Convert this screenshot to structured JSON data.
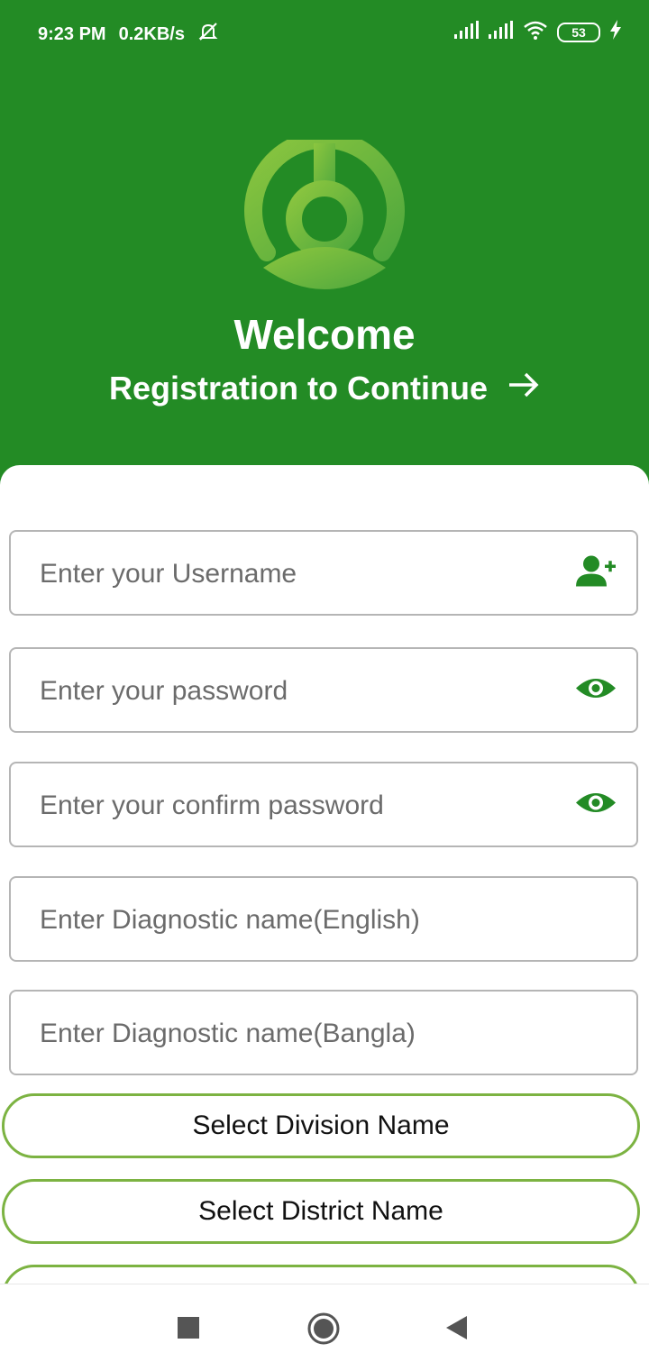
{
  "status_bar": {
    "time": "9:23 PM",
    "speed": "0.2KB/s",
    "battery": "53",
    "icons": [
      "mute-icon",
      "signal-icon",
      "signal-icon",
      "wifi-icon",
      "battery-icon",
      "charging-icon"
    ]
  },
  "header": {
    "title": "Welcome",
    "subtitle": "Registration to Continue",
    "arrow_icon": "arrow-right-icon",
    "background_color": "#238B25",
    "logo_color": "#6DB33F"
  },
  "form": {
    "username": {
      "placeholder": "Enter your Username",
      "value": "",
      "icon": "add-user-icon"
    },
    "password": {
      "placeholder": "Enter your password",
      "value": "",
      "icon": "eye-icon"
    },
    "confirm_password": {
      "placeholder": "Enter your confirm password",
      "value": "",
      "icon": "eye-icon"
    },
    "diag_name_en": {
      "placeholder": "Enter Diagnostic name(English)",
      "value": ""
    },
    "diag_name_bn": {
      "placeholder": "Enter Diagnostic name(Bangla)",
      "value": ""
    },
    "division_select": "Select Division Name",
    "district_select": "Select District Name",
    "accent_color": "#7CB342"
  },
  "nav_bar": {
    "buttons": [
      "recents-square-icon",
      "home-circle-icon",
      "back-triangle-icon"
    ]
  }
}
